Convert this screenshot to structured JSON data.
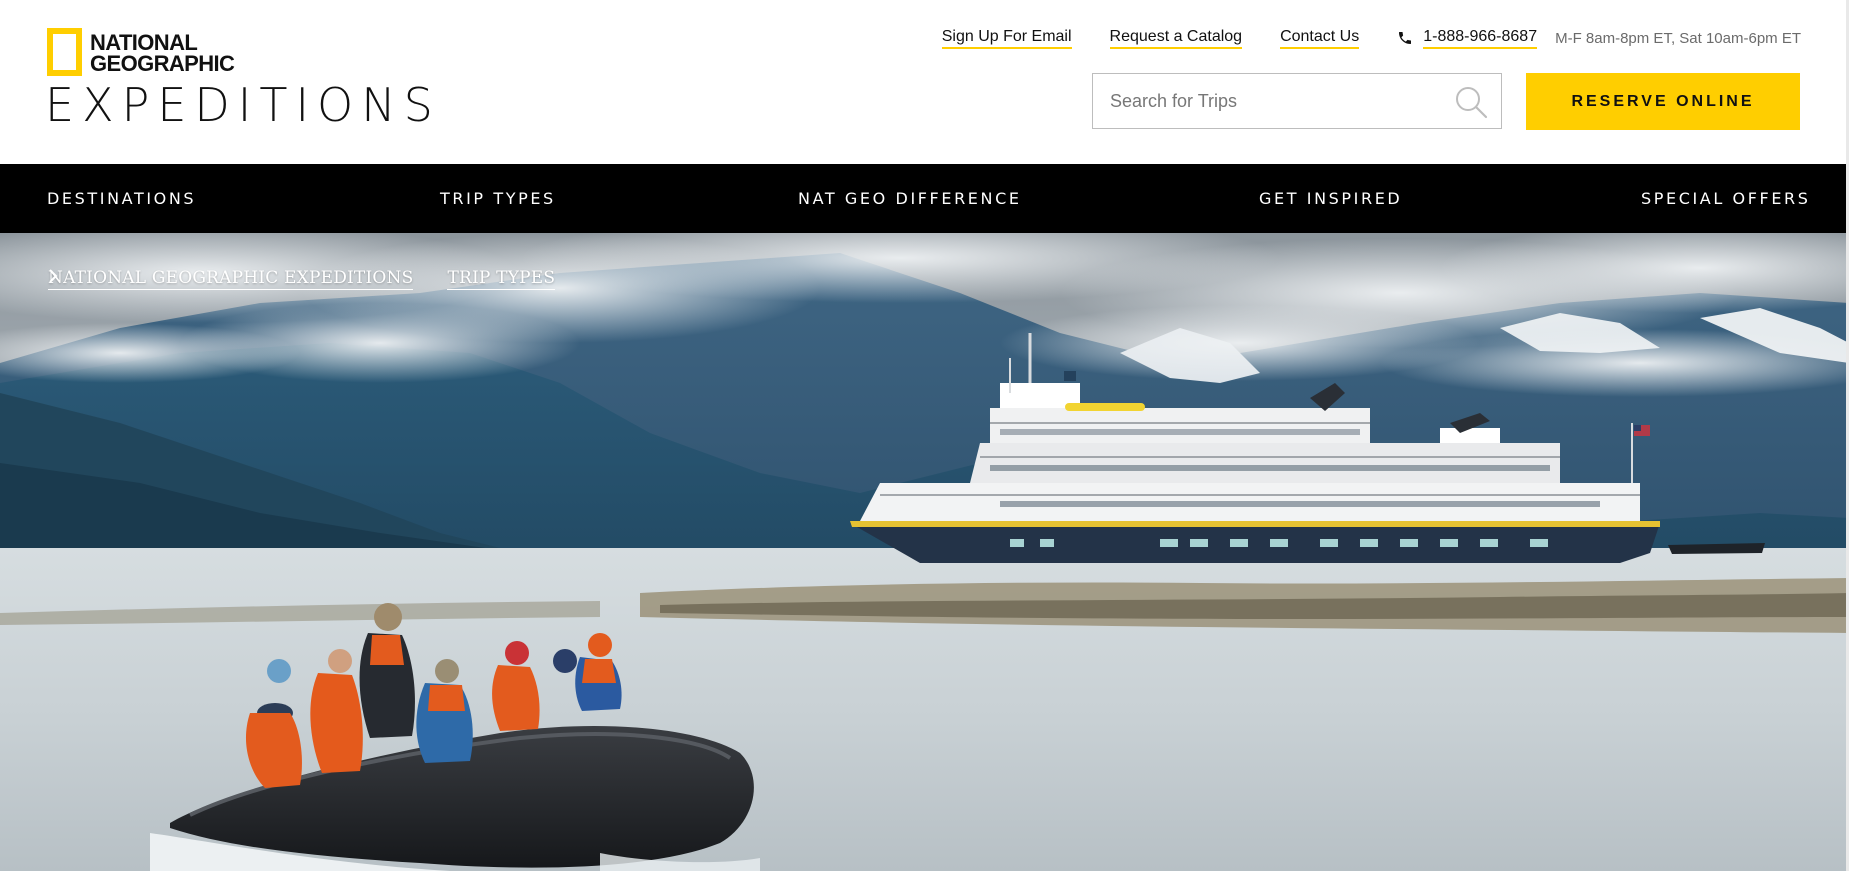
{
  "brand": {
    "name_line1": "NATIONAL",
    "name_line2": "GEOGRAPHIC",
    "product": "EXPEDITIONS",
    "accent_color": "#ffce00"
  },
  "utility_nav": {
    "links": [
      "Sign Up For Email",
      "Request a Catalog",
      "Contact Us"
    ],
    "phone_icon": "phone-icon",
    "phone": "1-888-966-8687",
    "hours": "M-F 8am-8pm ET, Sat 10am-6pm ET"
  },
  "search": {
    "placeholder": "Search for Trips",
    "value": "",
    "icon": "search-icon"
  },
  "reserve": {
    "label": "RESERVE ONLINE",
    "color": "#ffce00"
  },
  "main_nav": {
    "items": [
      "DESTINATIONS",
      "TRIP TYPES",
      "NAT GEO DIFFERENCE",
      "GET INSPIRED",
      "SPECIAL OFFERS"
    ],
    "background": "#000000"
  },
  "breadcrumb": {
    "items": [
      "NATIONAL GEOGRAPHIC EXPEDITIONS",
      "TRIP TYPES"
    ],
    "separator_icon": "chevron-right-icon"
  },
  "hero": {
    "scene": "expedition-ship-and-zodiac-in-alaskan-fjord"
  }
}
